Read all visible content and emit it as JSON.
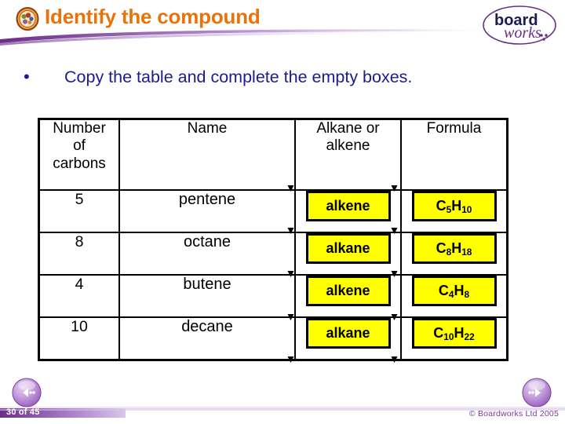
{
  "slide": {
    "title": "Identify the compound",
    "title_color": "#E8730C",
    "title_icon": "compound-badge-icon",
    "logo": {
      "word_bold": "board",
      "word_script": "works"
    },
    "bullet": {
      "marker": "•",
      "text": "Copy the table and complete the empty boxes.",
      "text_color": "#1B1B8F"
    },
    "footer": {
      "page_number": "30 of 45",
      "copyright": "© Boardworks Ltd 2005",
      "bar_color": "#9B6FC4"
    },
    "navigation": {
      "prev_label": "previous-slide",
      "next_label": "next-slide"
    }
  },
  "table": {
    "highlight_color": "#FFFF00",
    "headers": [
      "Number of carbons",
      "Name",
      "Alkane or alkene",
      "Formula"
    ],
    "headers_lines": [
      [
        "Number",
        "of",
        "carbons"
      ],
      [
        "Name"
      ],
      [
        "Alkane or",
        "alkene"
      ],
      [
        "Formula"
      ]
    ],
    "rows": [
      {
        "carbons": "5",
        "name": "pentene",
        "type": "alkene",
        "formula_plain": "C5H10",
        "formula_parts": [
          "C",
          "5",
          "H",
          "10"
        ]
      },
      {
        "carbons": "8",
        "name": "octane",
        "type": "alkane",
        "formula_plain": "C8H18",
        "formula_parts": [
          "C",
          "8",
          "H",
          "18"
        ]
      },
      {
        "carbons": "4",
        "name": "butene",
        "type": "alkene",
        "formula_plain": "C4H8",
        "formula_parts": [
          "C",
          "4",
          "H",
          "8"
        ]
      },
      {
        "carbons": "10",
        "name": "decane",
        "type": "alkane",
        "formula_plain": "C10H22",
        "formula_parts": [
          "C",
          "10",
          "H",
          "22"
        ]
      }
    ]
  }
}
